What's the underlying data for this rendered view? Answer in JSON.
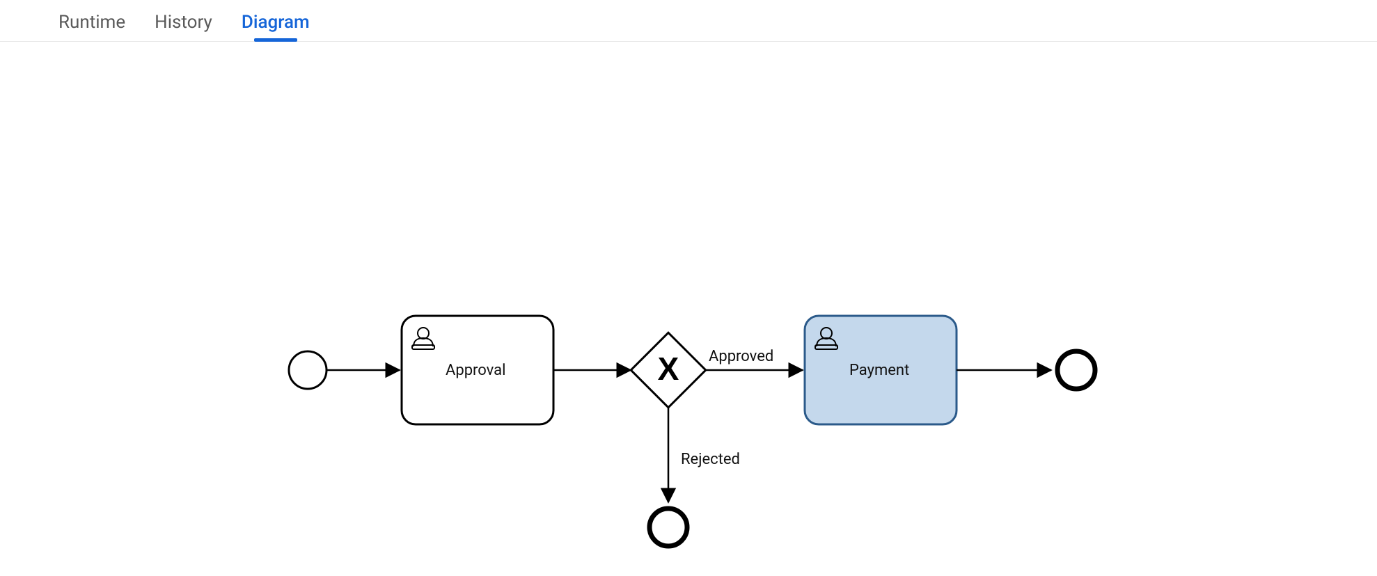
{
  "tabs": [
    {
      "label": "Runtime",
      "active": false
    },
    {
      "label": "History",
      "active": false
    },
    {
      "label": "Diagram",
      "active": true
    }
  ],
  "diagram": {
    "nodes": {
      "start": {
        "type": "start-event"
      },
      "approval": {
        "type": "user-task",
        "label": "Approval",
        "highlighted": false
      },
      "gateway": {
        "type": "exclusive-gateway"
      },
      "payment": {
        "type": "user-task",
        "label": "Payment",
        "highlighted": true
      },
      "end": {
        "type": "end-event"
      },
      "endRej": {
        "type": "end-event"
      }
    },
    "flows": {
      "approved": {
        "label": "Approved"
      },
      "rejected": {
        "label": "Rejected"
      }
    },
    "colors": {
      "highlight_fill": "#c4d8ec",
      "highlight_stroke": "#2b5a8a"
    }
  }
}
